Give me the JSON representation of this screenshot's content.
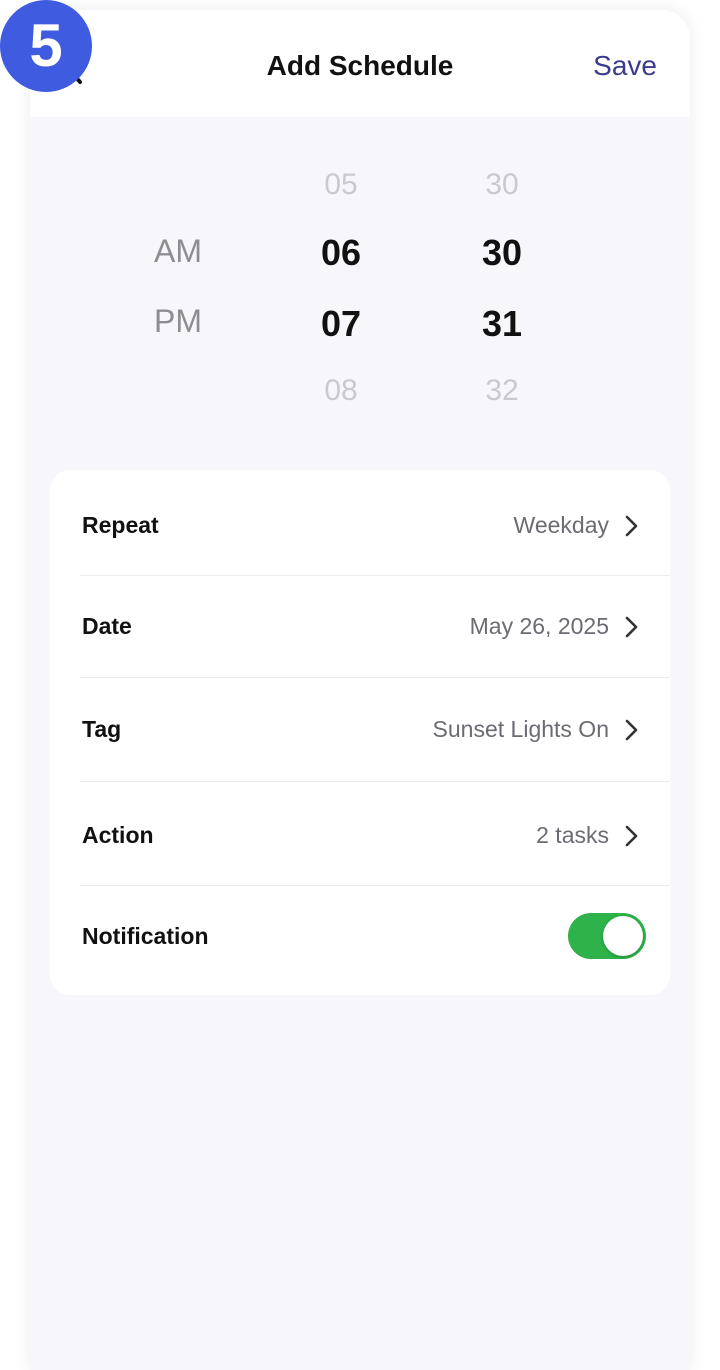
{
  "step_badge": "5",
  "header": {
    "title": "Add Schedule",
    "save_label": "Save",
    "back_icon": "chevron-left-icon"
  },
  "time_picker": {
    "ampm": {
      "options": [
        "AM",
        "PM"
      ]
    },
    "hours": {
      "above": "05",
      "values": [
        "06",
        "07"
      ],
      "below": "08"
    },
    "minutes": {
      "above": "30",
      "values": [
        "30",
        "31"
      ],
      "below": "32"
    }
  },
  "settings": {
    "repeat": {
      "label": "Repeat",
      "value": "Weekday"
    },
    "date": {
      "label": "Date",
      "value": "May 26, 2025"
    },
    "tag": {
      "label": "Tag",
      "value": "Sunset Lights On"
    },
    "action": {
      "label": "Action",
      "value": "2 tasks"
    },
    "notification": {
      "label": "Notification",
      "enabled": true
    }
  },
  "colors": {
    "accent": "#3b3b8f",
    "badge": "#3f5be0",
    "toggle_on": "#2db34a",
    "background": "#f7f7fb"
  }
}
